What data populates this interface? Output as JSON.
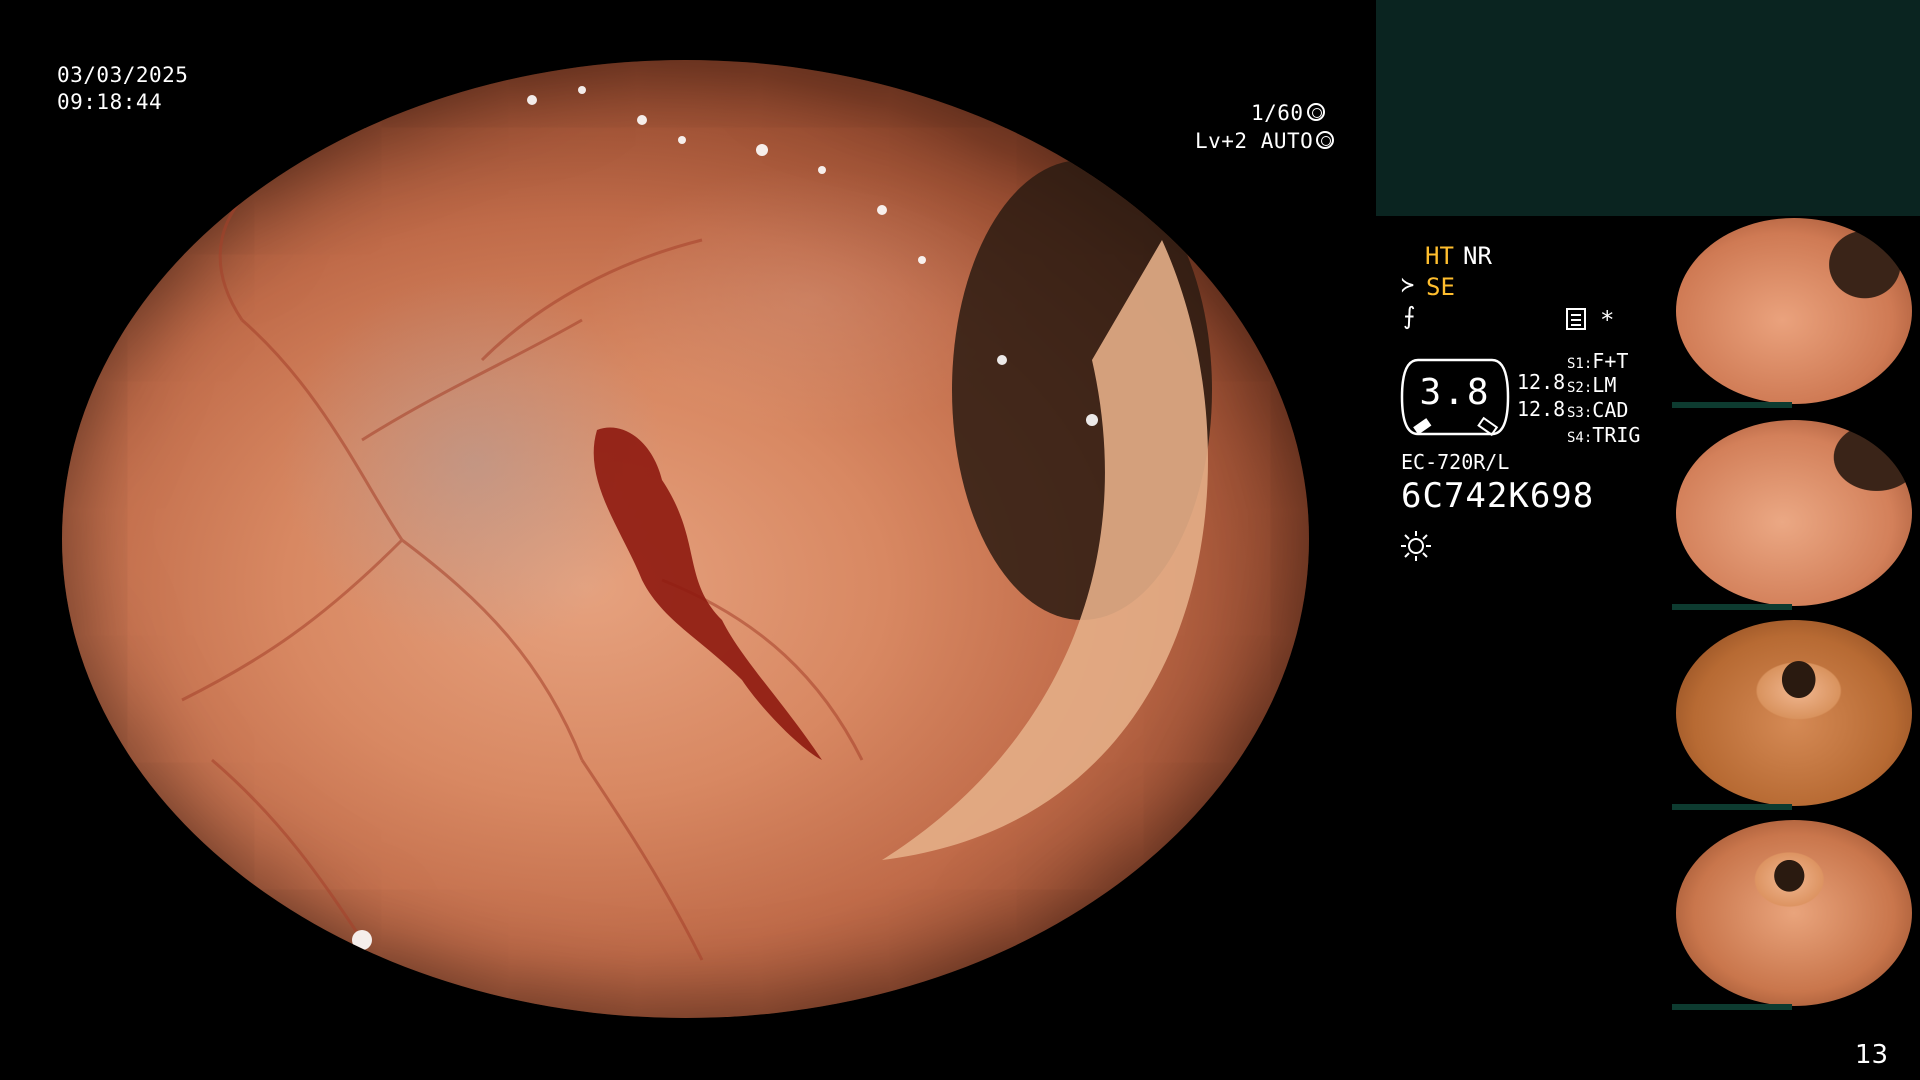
{
  "osd": {
    "date": "03/03/2025",
    "time": "09:18:44",
    "shutter": "1/60",
    "level": "Lv+2 AUTO"
  },
  "panel": {
    "ht": "HT",
    "nr": "NR",
    "se": "SE",
    "asterisk": "*",
    "gauge_value": "3.8",
    "gauge_sub_1": "12.8",
    "gauge_sub_2": "12.8",
    "slots": [
      {
        "key": "S1:",
        "value": "F+T"
      },
      {
        "key": "S2:",
        "value": "LM"
      },
      {
        "key": "S3:",
        "value": "CAD"
      },
      {
        "key": "S4:",
        "value": "TRIG"
      }
    ],
    "scope_model": "EC-720R/L",
    "serial": "6C742K698"
  },
  "icons": {
    "shutter": "shutter-icon",
    "auto": "iris-icon",
    "se": "enhancement-icon",
    "f": "f-mode-icon",
    "menu": "menu-icon",
    "light": "light-icon"
  },
  "page_number": "13"
}
